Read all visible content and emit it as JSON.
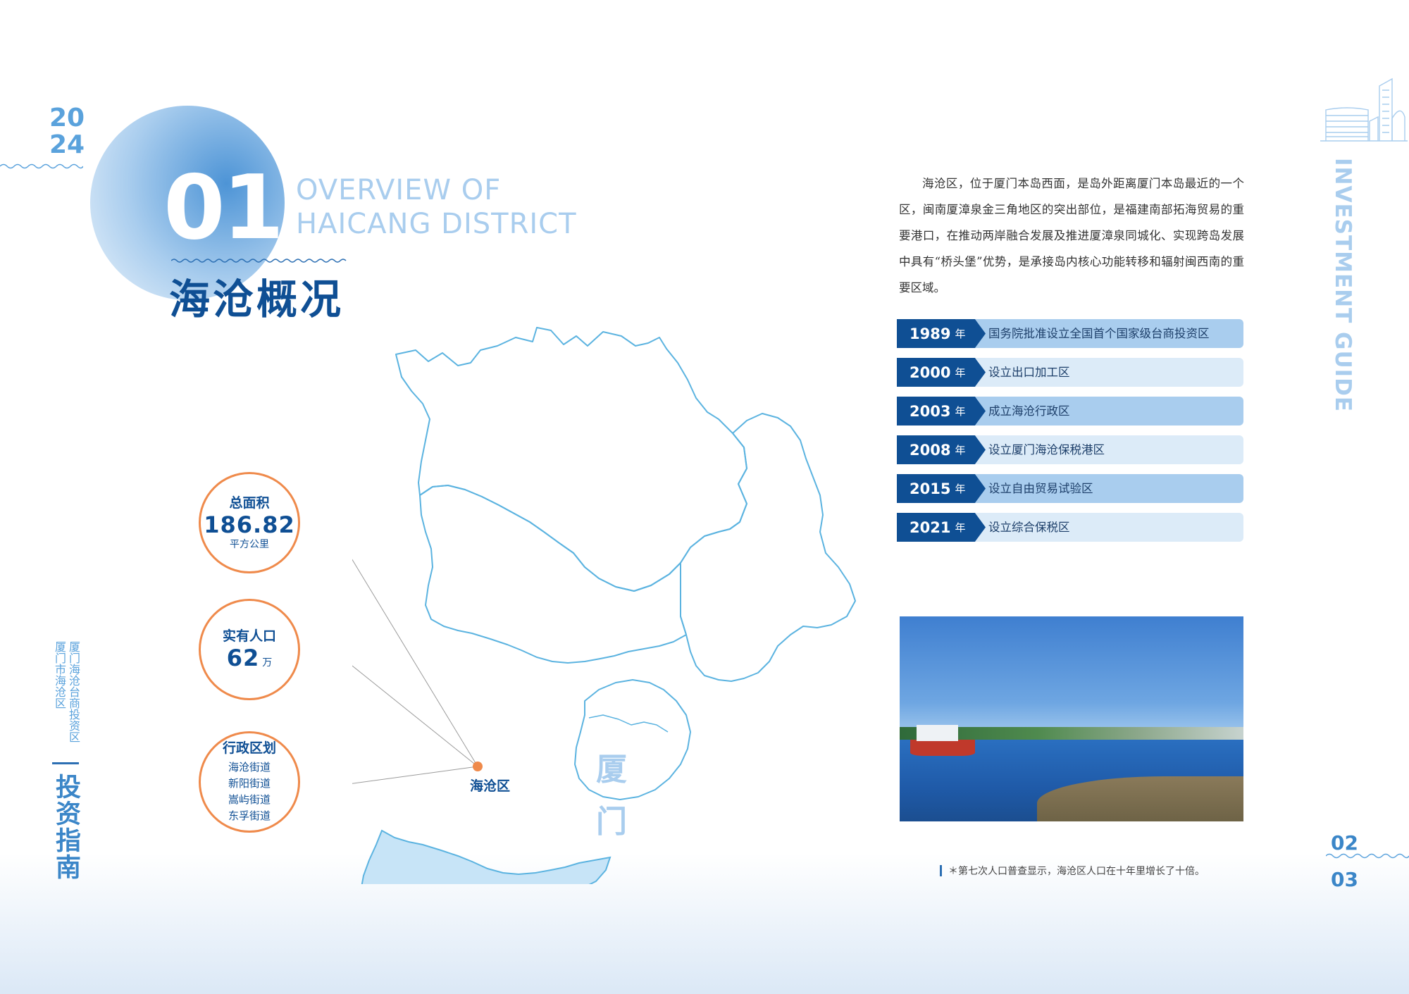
{
  "header": {
    "year_top": "20",
    "year_bottom": "24",
    "section_number": "01",
    "title_en_line1": "OVERVIEW OF",
    "title_en_line2": "HAICANG DISTRICT",
    "title_cn": "海沧概况"
  },
  "right_side": {
    "vertical_en": "INVESTMENT GUIDE"
  },
  "left_side": {
    "vertical_cn_col1": "厦门海沧台商投资区",
    "vertical_cn_col2": "厦门市海沧区",
    "vertical_main": "投资指南"
  },
  "intro": {
    "text": "海沧区，位于厦门本岛西面，是岛外距离厦门本岛最近的一个区，闽南厦漳泉金三角地区的突出部位，是福建南部拓海贸易的重要港口，在推动两岸融合发展及推进厦漳泉同城化、实现跨岛发展中具有“桥头堡”优势，是承接岛内核心功能转移和辐射闽西南的重要区域。"
  },
  "timeline": {
    "year_unit": "年",
    "items": [
      {
        "year": "1989",
        "text": "国务院批准设立全国首个国家级台商投资区"
      },
      {
        "year": "2000",
        "text": "设立出口加工区"
      },
      {
        "year": "2003",
        "text": "成立海沧行政区"
      },
      {
        "year": "2008",
        "text": "设立厦门海沧保税港区"
      },
      {
        "year": "2015",
        "text": "设立自由贸易试验区"
      },
      {
        "year": "2021",
        "text": "设立综合保税区"
      }
    ]
  },
  "stats": {
    "area": {
      "label": "总面积",
      "value": "186.82",
      "unit": "平方公里"
    },
    "population": {
      "label": "实有人口",
      "value": "62",
      "unit": "万"
    },
    "admin": {
      "label": "行政区划",
      "items": [
        "海沧街道",
        "新阳街道",
        "嵩屿街道",
        "东孚街道"
      ]
    }
  },
  "map": {
    "district_label": "海沧区",
    "xiamen_char1": "厦",
    "xiamen_char2": "门"
  },
  "footnote": "＊第七次人口普查显示，海沧区人口在十年里增长了十倍。",
  "pages": {
    "left": "02",
    "right": "03"
  },
  "colors": {
    "navy": "#0f4f94",
    "light_blue": "#a9cdee",
    "orange": "#ef8a4b",
    "map_fill": "#c7e4f7",
    "map_stroke": "#5bb3e0"
  }
}
